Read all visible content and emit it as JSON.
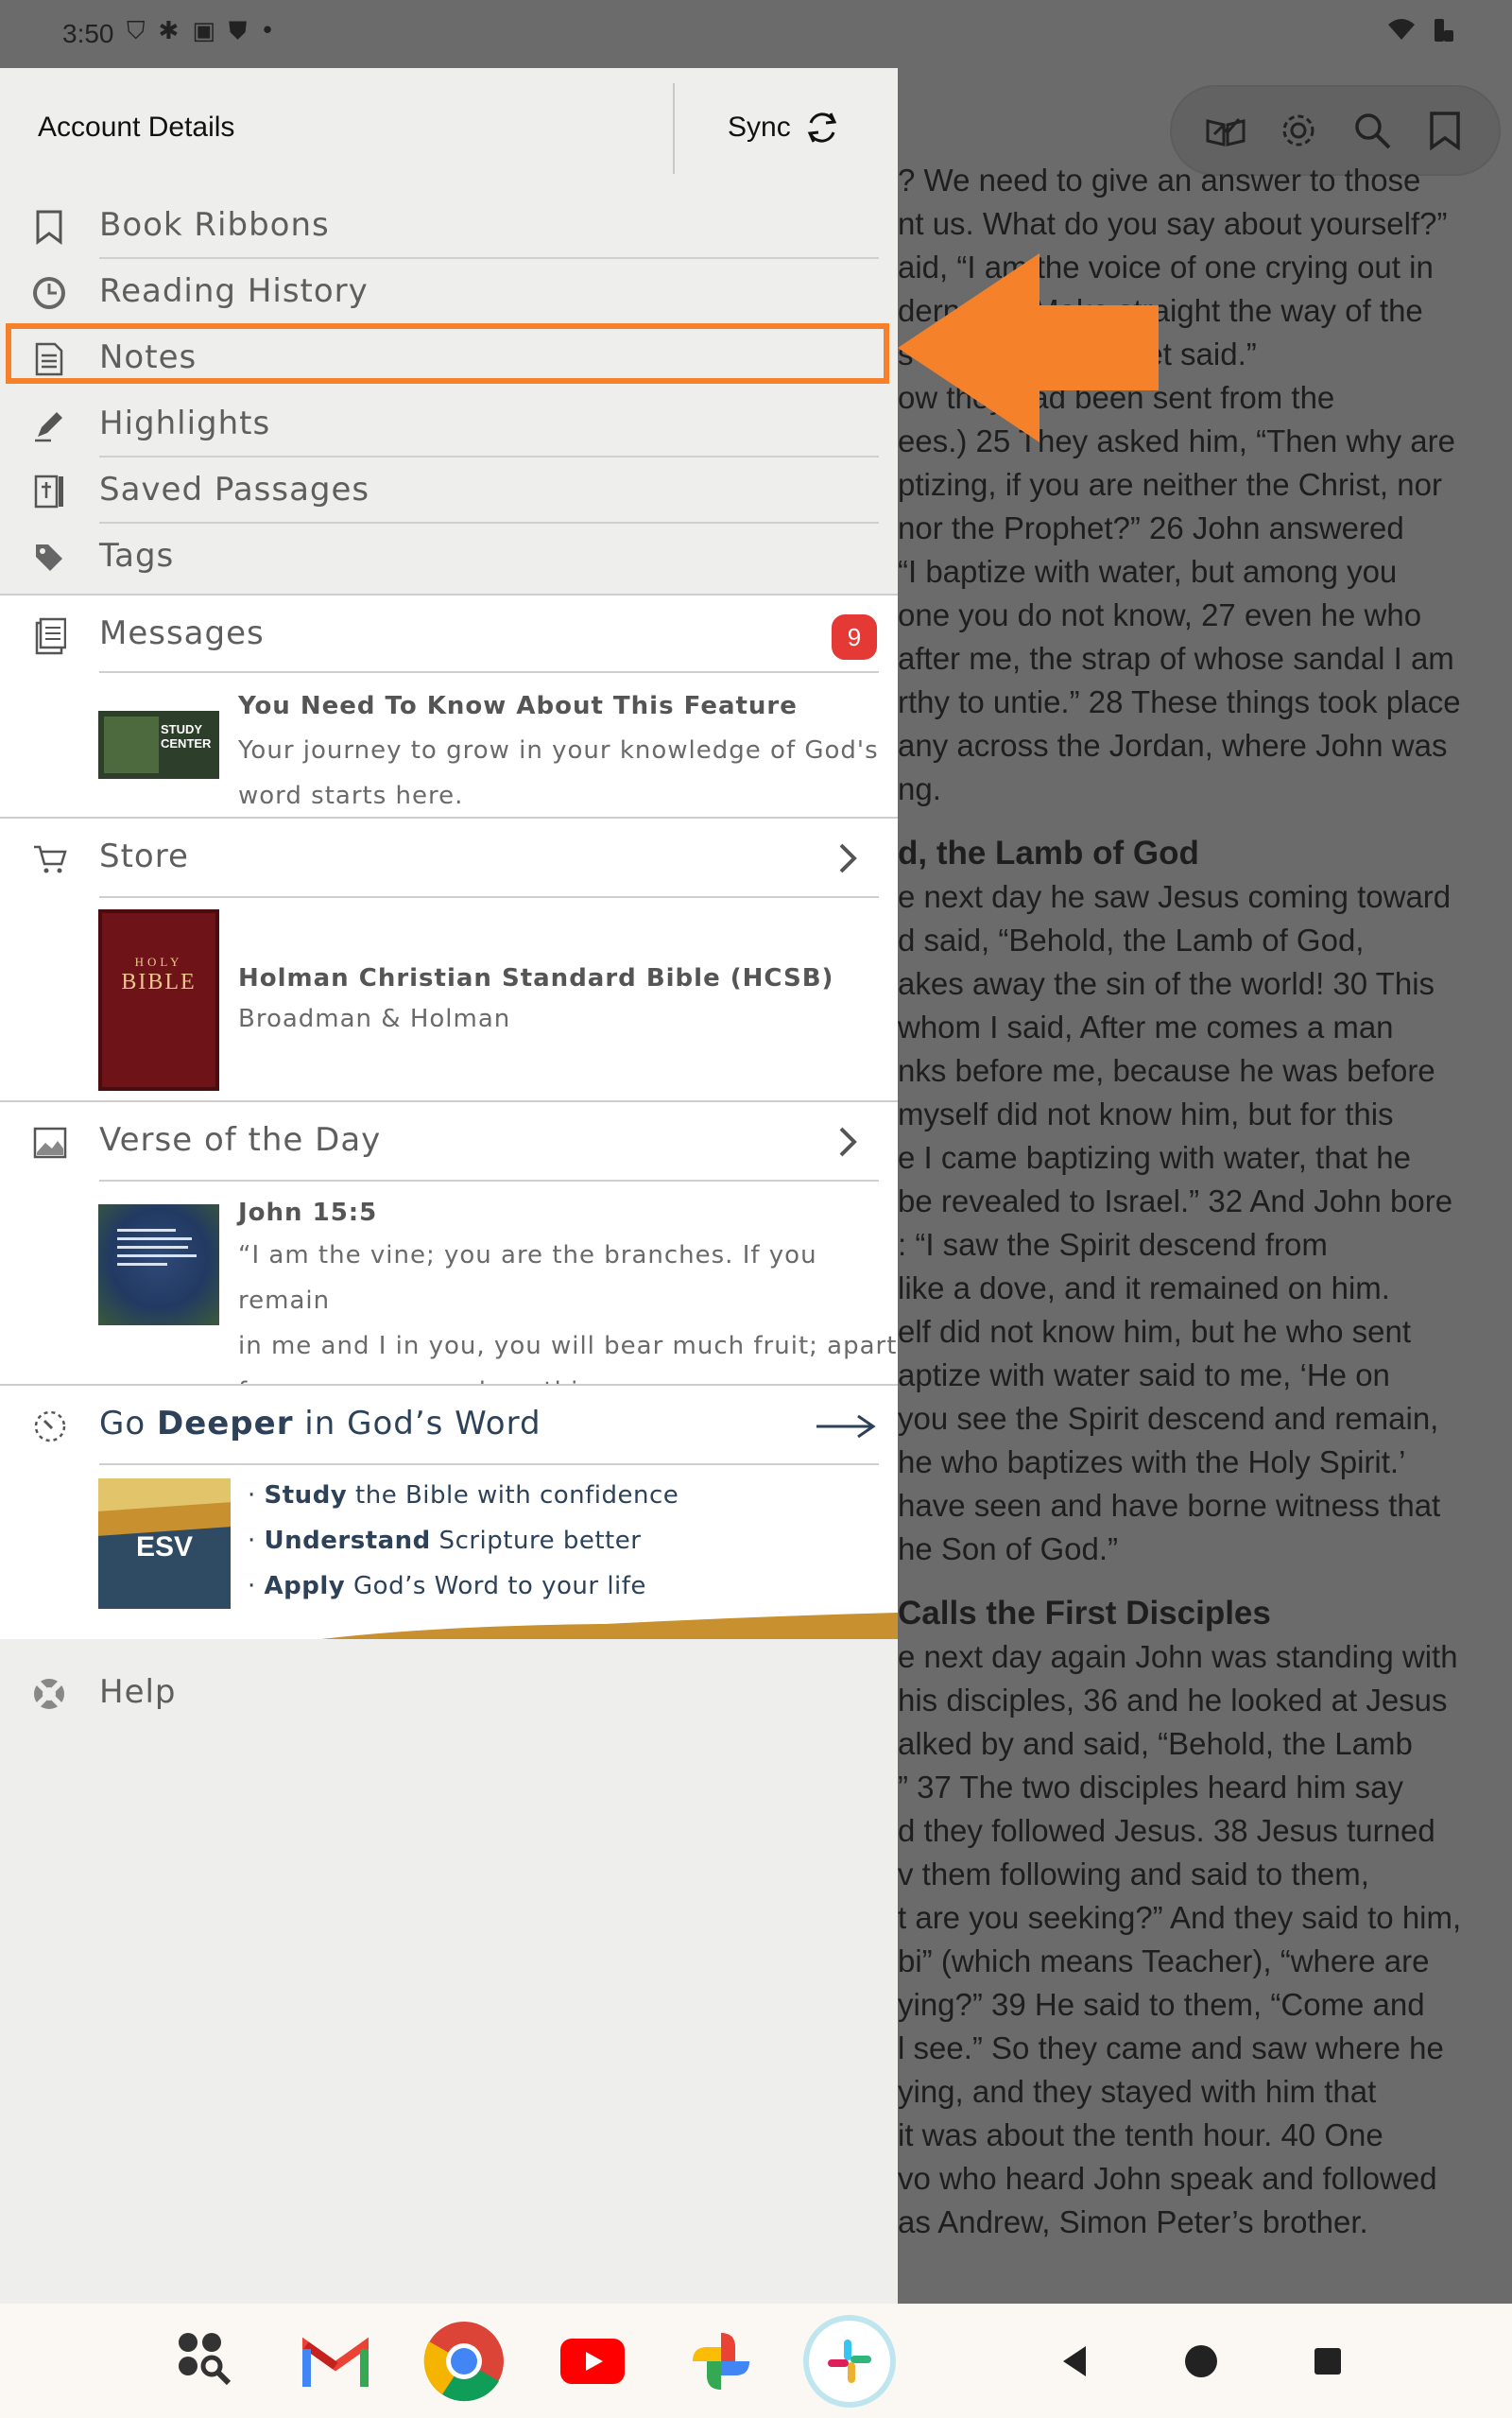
{
  "status_bar": {
    "time": "3:50",
    "left_icons": [
      "shield-icon",
      "bug-icon",
      "download-icon",
      "shield-check-icon",
      "dot-icon"
    ],
    "right_icons": [
      "wifi-icon",
      "cast-icon"
    ]
  },
  "drawer": {
    "account_label": "Account Details",
    "sync_label": "Sync",
    "menu": [
      {
        "label": "Book Ribbons",
        "icon": "bookmark-icon"
      },
      {
        "label": "Reading History",
        "icon": "clock-icon"
      },
      {
        "label": "Notes",
        "icon": "note-icon",
        "highlighted": true
      },
      {
        "label": "Highlights",
        "icon": "pen-icon"
      },
      {
        "label": "Saved Passages",
        "icon": "saved-passage-icon"
      },
      {
        "label": "Tags",
        "icon": "tag-icon"
      }
    ],
    "messages": {
      "label": "Messages",
      "badge": "9",
      "item": {
        "title": "You Need To Know About This Feature",
        "body": [
          "Your journey to grow in your knowledge of God's",
          "word starts here."
        ],
        "thumb_text": [
          "STUDY",
          "CENTER"
        ]
      }
    },
    "store": {
      "label": "Store",
      "item": {
        "title": "Holman Christian Standard Bible (HCSB)",
        "publisher": "Broadman & Holman",
        "cover_text": [
          "HOLY",
          "BIBLE"
        ]
      }
    },
    "verse_of_day": {
      "label": "Verse of the Day",
      "reference": "John 15:5",
      "text": [
        "“I am the vine; you are the branches. If you remain",
        "in me and I in you, you will bear much fruit; apart",
        "from me you can do nothing."
      ]
    },
    "go_deeper": {
      "label_prefix": "Go ",
      "label_bold": "Deeper",
      "label_suffix": " in God’s Word",
      "thumb_text": "ESV",
      "bullets": [
        {
          "bold": "Study",
          "rest": " the Bible with confidence"
        },
        {
          "bold": "Understand",
          "rest": " Scripture better"
        },
        {
          "bold": "Apply",
          "rest": " God’s Word to your life"
        }
      ]
    },
    "help_label": "Help"
  },
  "reader": {
    "toolbar_icons": [
      "reading-plan-icon",
      "gear-icon",
      "search-icon",
      "bookmark-icon"
    ],
    "lines": [
      "? We need to give an answer to those",
      "nt us. What do you say about yourself?”",
      "aid, “I am the voice of one crying out in",
      "derness, ‘Make straight the way of the",
      "s Isaiah the prophet said.”",
      "ow they had been sent from the",
      "ees.) 25 They asked him, “Then why are",
      "ptizing, if you are neither the Christ, nor",
      "nor the Prophet?” 26 John answered",
      "“I baptize with water, but among you",
      "one you do not know, 27 even he who",
      "after me, the strap of whose sandal I am",
      "rthy to untie.” 28 These things took place",
      "any across the Jordan, where John was",
      "ng."
    ],
    "heading1": "d, the Lamb of God",
    "lines2": [
      "e next day he saw Jesus coming toward",
      "d said, “Behold, the Lamb of God,",
      "akes away the sin of the world! 30 This",
      "whom I said, After me comes a man",
      "nks before me, because he was before",
      " myself did not know him, but for this",
      "e I came baptizing with water, that he",
      "be revealed to Israel.” 32 And John bore",
      ": “I saw the Spirit descend from",
      " like a dove, and it remained on him.",
      "elf did not know him, but he who sent",
      "aptize with water said to me, ‘He on",
      "you see the Spirit descend and remain,",
      " he who baptizes with the Holy Spirit.’",
      " have seen and have borne witness that",
      "he Son of God.”"
    ],
    "heading2": "Calls the First Disciples",
    "lines3": [
      "e next day again John was standing with",
      "his disciples, 36 and he looked at Jesus",
      "alked by and said, “Behold, the Lamb",
      "” 37 The two disciples heard him say",
      "d they followed Jesus. 38 Jesus turned",
      "v them following and said to them,",
      "t are you seeking?” And they said to him,",
      "bi” (which means Teacher), “where are",
      "ying?” 39 He said to them, “Come and",
      "l see.” So they came and saw where he",
      "ying, and they stayed with him that",
      " it was about the tenth hour. 40 One",
      "vo who heard John speak and followed",
      " as Andrew, Simon Peter’s brother."
    ]
  },
  "dock": {
    "apps": [
      "app-drawer-search-icon",
      "gmail-icon",
      "chrome-icon",
      "youtube-icon",
      "photos-icon",
      "slack-icon"
    ],
    "nav": [
      "back-icon",
      "home-icon",
      "recents-icon"
    ]
  },
  "colors": {
    "accent_orange": "#f5822a",
    "badge_red": "#e53935",
    "esv_navy": "#2f4a63",
    "esv_gold": "#c8902f"
  }
}
